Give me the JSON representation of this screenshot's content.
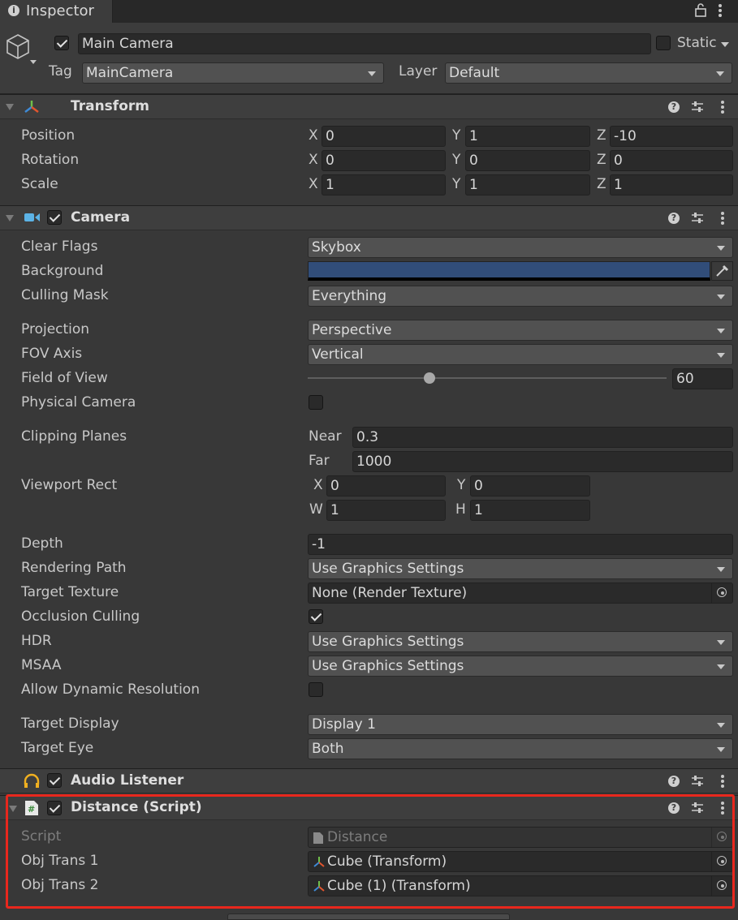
{
  "tab": {
    "title": "Inspector",
    "lock_icon": "lock-icon",
    "menu_icon": "kebab-icon"
  },
  "gameobject": {
    "name": "Main Camera",
    "active": true,
    "static_label": "Static",
    "static": false,
    "tag_label": "Tag",
    "tag": "MainCamera",
    "layer_label": "Layer",
    "layer": "Default"
  },
  "transform": {
    "title": "Transform",
    "rows": [
      {
        "label": "Position",
        "x": "0",
        "y": "1",
        "z": "-10"
      },
      {
        "label": "Rotation",
        "x": "0",
        "y": "0",
        "z": "0"
      },
      {
        "label": "Scale",
        "x": "1",
        "y": "1",
        "z": "1"
      }
    ],
    "axis": {
      "x": "X",
      "y": "Y",
      "z": "Z"
    }
  },
  "camera": {
    "title": "Camera",
    "enabled": true,
    "clear_flags": {
      "label": "Clear Flags",
      "value": "Skybox"
    },
    "background": {
      "label": "Background",
      "color": "#314d79"
    },
    "culling_mask": {
      "label": "Culling Mask",
      "value": "Everything"
    },
    "projection": {
      "label": "Projection",
      "value": "Perspective"
    },
    "fov_axis": {
      "label": "FOV Axis",
      "value": "Vertical"
    },
    "field_of_view": {
      "label": "Field of View",
      "value": "60",
      "slider_fraction": 0.34
    },
    "physical_camera": {
      "label": "Physical Camera",
      "checked": false
    },
    "clipping": {
      "label": "Clipping Planes",
      "near_label": "Near",
      "near": "0.3",
      "far_label": "Far",
      "far": "1000"
    },
    "viewport": {
      "label": "Viewport Rect",
      "x_label": "X",
      "x": "0",
      "y_label": "Y",
      "y": "0",
      "w_label": "W",
      "w": "1",
      "h_label": "H",
      "h": "1"
    },
    "depth": {
      "label": "Depth",
      "value": "-1"
    },
    "rendering_path": {
      "label": "Rendering Path",
      "value": "Use Graphics Settings"
    },
    "target_texture": {
      "label": "Target Texture",
      "value": "None (Render Texture)"
    },
    "occlusion_culling": {
      "label": "Occlusion Culling",
      "checked": true
    },
    "hdr": {
      "label": "HDR",
      "value": "Use Graphics Settings"
    },
    "msaa": {
      "label": "MSAA",
      "value": "Use Graphics Settings"
    },
    "dynamic_resolution": {
      "label": "Allow Dynamic Resolution",
      "checked": false
    },
    "target_display": {
      "label": "Target Display",
      "value": "Display 1"
    },
    "target_eye": {
      "label": "Target Eye",
      "value": "Both"
    }
  },
  "audio_listener": {
    "title": "Audio Listener",
    "enabled": true
  },
  "distance_script": {
    "title": "Distance (Script)",
    "enabled": true,
    "script": {
      "label": "Script",
      "value": "Distance"
    },
    "obj_trans_1": {
      "label": "Obj Trans 1",
      "value": "Cube (Transform)"
    },
    "obj_trans_2": {
      "label": "Obj Trans 2",
      "value": "Cube (1) (Transform)"
    }
  },
  "colors": {
    "highlight": "#e8271d",
    "background": "#383838"
  }
}
